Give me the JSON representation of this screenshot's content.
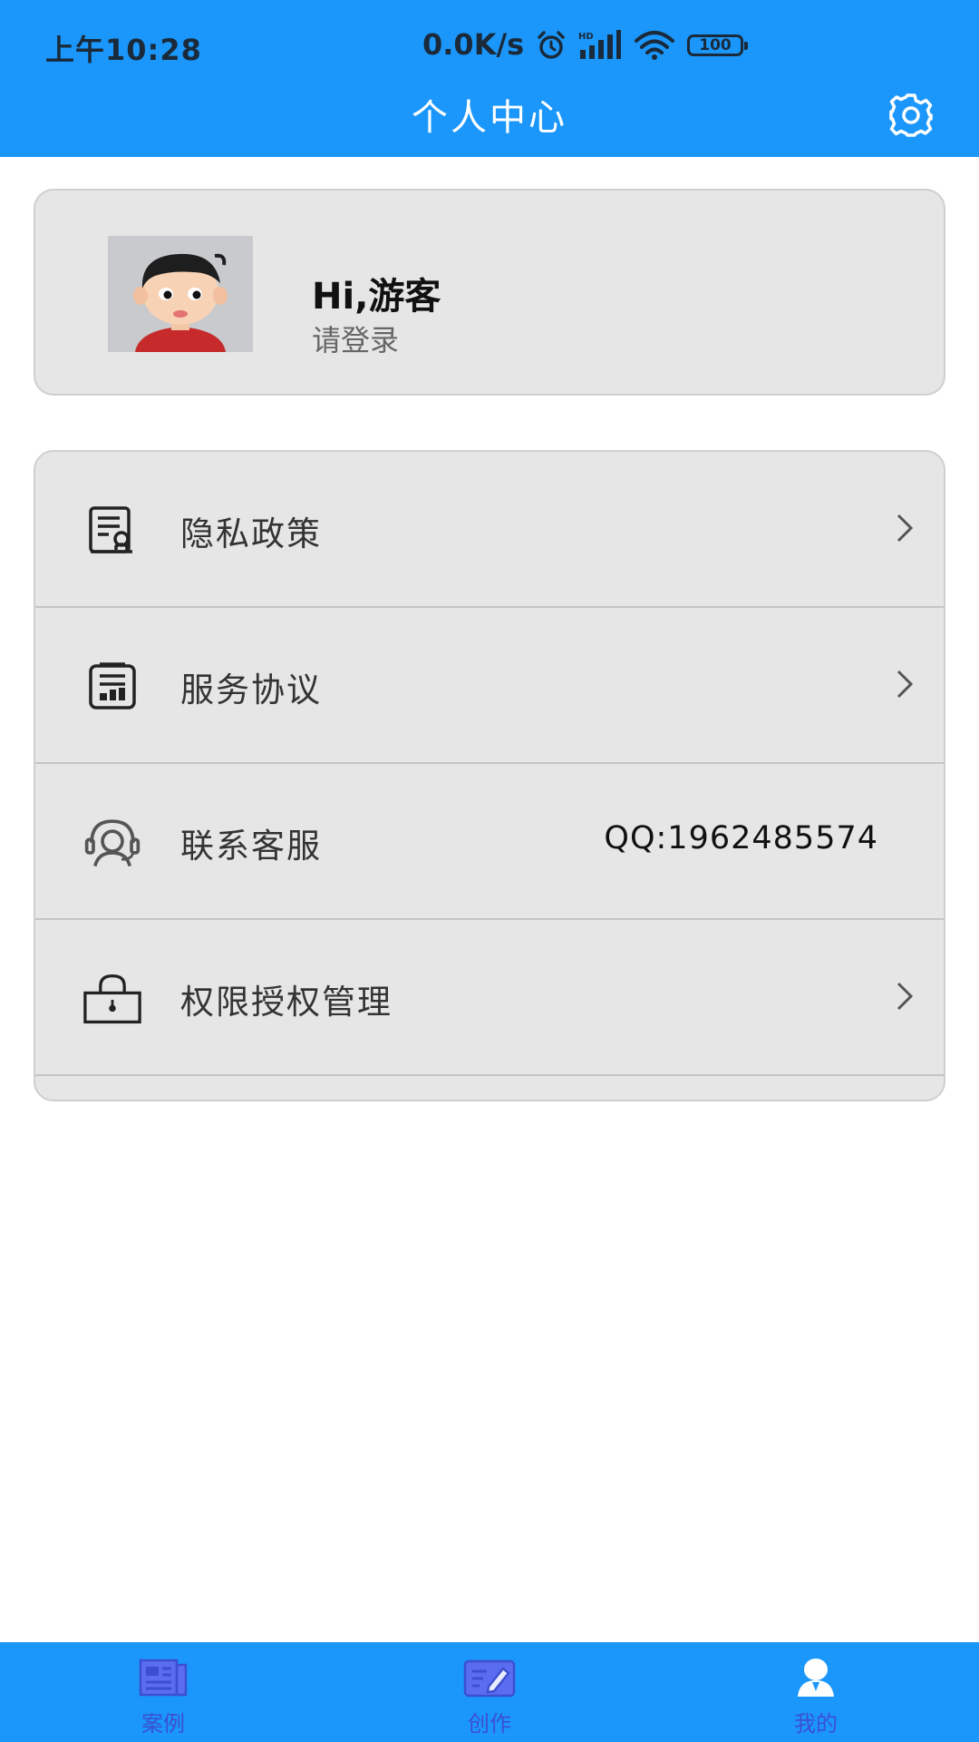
{
  "status_bar": {
    "time": "上午10:28",
    "network_speed": "0.0K/s",
    "battery": "100",
    "icons": [
      "alarm-icon",
      "hd-signal-icon",
      "wifi-icon",
      "battery-icon"
    ]
  },
  "header": {
    "title": "个人中心",
    "settings_icon": "gear-icon",
    "background": "#1b97fb"
  },
  "profile": {
    "greeting": "Hi,游客",
    "login_hint": "请登录",
    "avatar": "avatar-cartoon-boy"
  },
  "menu": {
    "items": [
      {
        "label": "隐私政策",
        "icon": "privacy-document-icon",
        "value": "",
        "has_chevron": true
      },
      {
        "label": "服务协议",
        "icon": "service-agreement-icon",
        "value": "",
        "has_chevron": true
      },
      {
        "label": "联系客服",
        "icon": "customer-service-icon",
        "value": "QQ:1962485574",
        "has_chevron": false
      },
      {
        "label": "权限授权管理",
        "icon": "lock-icon",
        "value": "",
        "has_chevron": true
      }
    ]
  },
  "tabbar": {
    "background": "#1b97fb",
    "label_color": "#3c4fd0",
    "tabs": [
      {
        "label": "案例",
        "icon": "news-icon",
        "active": false
      },
      {
        "label": "创作",
        "icon": "edit-icon",
        "active": false
      },
      {
        "label": "我的",
        "icon": "user-icon",
        "active": true
      }
    ]
  }
}
